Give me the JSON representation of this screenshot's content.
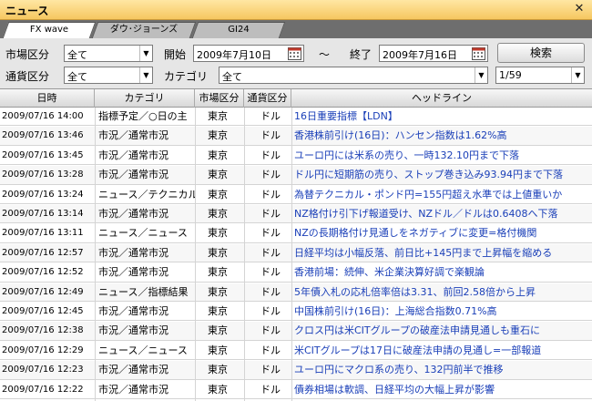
{
  "window": {
    "title": "ニュース"
  },
  "tabs": [
    "FX wave",
    "ダウ･ジョーンズ",
    "GI24"
  ],
  "filters": {
    "market_label": "市場区分",
    "market_value": "全て",
    "start_label": "開始",
    "start_date": "2009年7月10日",
    "range_sep": "～",
    "end_label": "終了",
    "end_date": "2009年7月16日",
    "search_button": "検索",
    "currency_label": "通貨区分",
    "currency_value": "全て",
    "category_label": "カテゴリ",
    "category_value": "全て",
    "page_value": "1/59"
  },
  "columns": [
    "日時",
    "カテゴリ",
    "市場区分",
    "通貨区分",
    "ヘッドライン"
  ],
  "rows": [
    {
      "date": "2009/07/16 14:00",
      "category": "指標予定／○日の主",
      "market": "東京",
      "currency": "ドル",
      "headline": "16日重要指標【LDN】"
    },
    {
      "date": "2009/07/16 13:46",
      "category": "市況／通常市況",
      "market": "東京",
      "currency": "ドル",
      "headline": "香港株前引け(16日)：ハンセン指数は1.62%高"
    },
    {
      "date": "2009/07/16 13:45",
      "category": "市況／通常市況",
      "market": "東京",
      "currency": "ドル",
      "headline": "ユーロ円には米系の売り、一時132.10円まで下落"
    },
    {
      "date": "2009/07/16 13:28",
      "category": "市況／通常市況",
      "market": "東京",
      "currency": "ドル",
      "headline": "ドル円に短期筋の売り、ストップ巻き込み93.94円まで下落"
    },
    {
      "date": "2009/07/16 13:24",
      "category": "ニュース／テクニカル",
      "market": "東京",
      "currency": "ドル",
      "headline": "為替テクニカル・ポンド円=155円超え水準では上値重いか"
    },
    {
      "date": "2009/07/16 13:14",
      "category": "市況／通常市況",
      "market": "東京",
      "currency": "ドル",
      "headline": "NZ格付け引下げ報道受け、NZドル／ドルは0.6408へ下落"
    },
    {
      "date": "2009/07/16 13:11",
      "category": "ニュース／ニュース",
      "market": "東京",
      "currency": "ドル",
      "headline": "NZの長期格付け見通しをネガティブに変更=格付機関"
    },
    {
      "date": "2009/07/16 12:57",
      "category": "市況／通常市況",
      "market": "東京",
      "currency": "ドル",
      "headline": "日経平均は小幅反落、前日比+145円まで上昇幅を縮める"
    },
    {
      "date": "2009/07/16 12:52",
      "category": "市況／通常市況",
      "market": "東京",
      "currency": "ドル",
      "headline": "香港前場：続伸、米企業決算好調で楽観論"
    },
    {
      "date": "2009/07/16 12:49",
      "category": "ニュース／指標結果",
      "market": "東京",
      "currency": "ドル",
      "headline": "5年債入札の応札倍率倍は3.31、前回2.58倍から上昇"
    },
    {
      "date": "2009/07/16 12:45",
      "category": "市況／通常市況",
      "market": "東京",
      "currency": "ドル",
      "headline": "中国株前引け(16日)：上海総合指数0.71%高"
    },
    {
      "date": "2009/07/16 12:38",
      "category": "市況／通常市況",
      "market": "東京",
      "currency": "ドル",
      "headline": "クロス円は米CITグループの破産法申請見通しも重石に"
    },
    {
      "date": "2009/07/16 12:29",
      "category": "ニュース／ニュース",
      "market": "東京",
      "currency": "ドル",
      "headline": "米CITグループは17日に破産法申請の見通し=一部報道"
    },
    {
      "date": "2009/07/16 12:23",
      "category": "市況／通常市況",
      "market": "東京",
      "currency": "ドル",
      "headline": "ユーロ円にマクロ系の売り、132円前半で推移"
    },
    {
      "date": "2009/07/16 12:22",
      "category": "市況／通常市況",
      "market": "東京",
      "currency": "ドル",
      "headline": "債券相場は軟調、日経平均の大幅上昇が影響"
    }
  ]
}
